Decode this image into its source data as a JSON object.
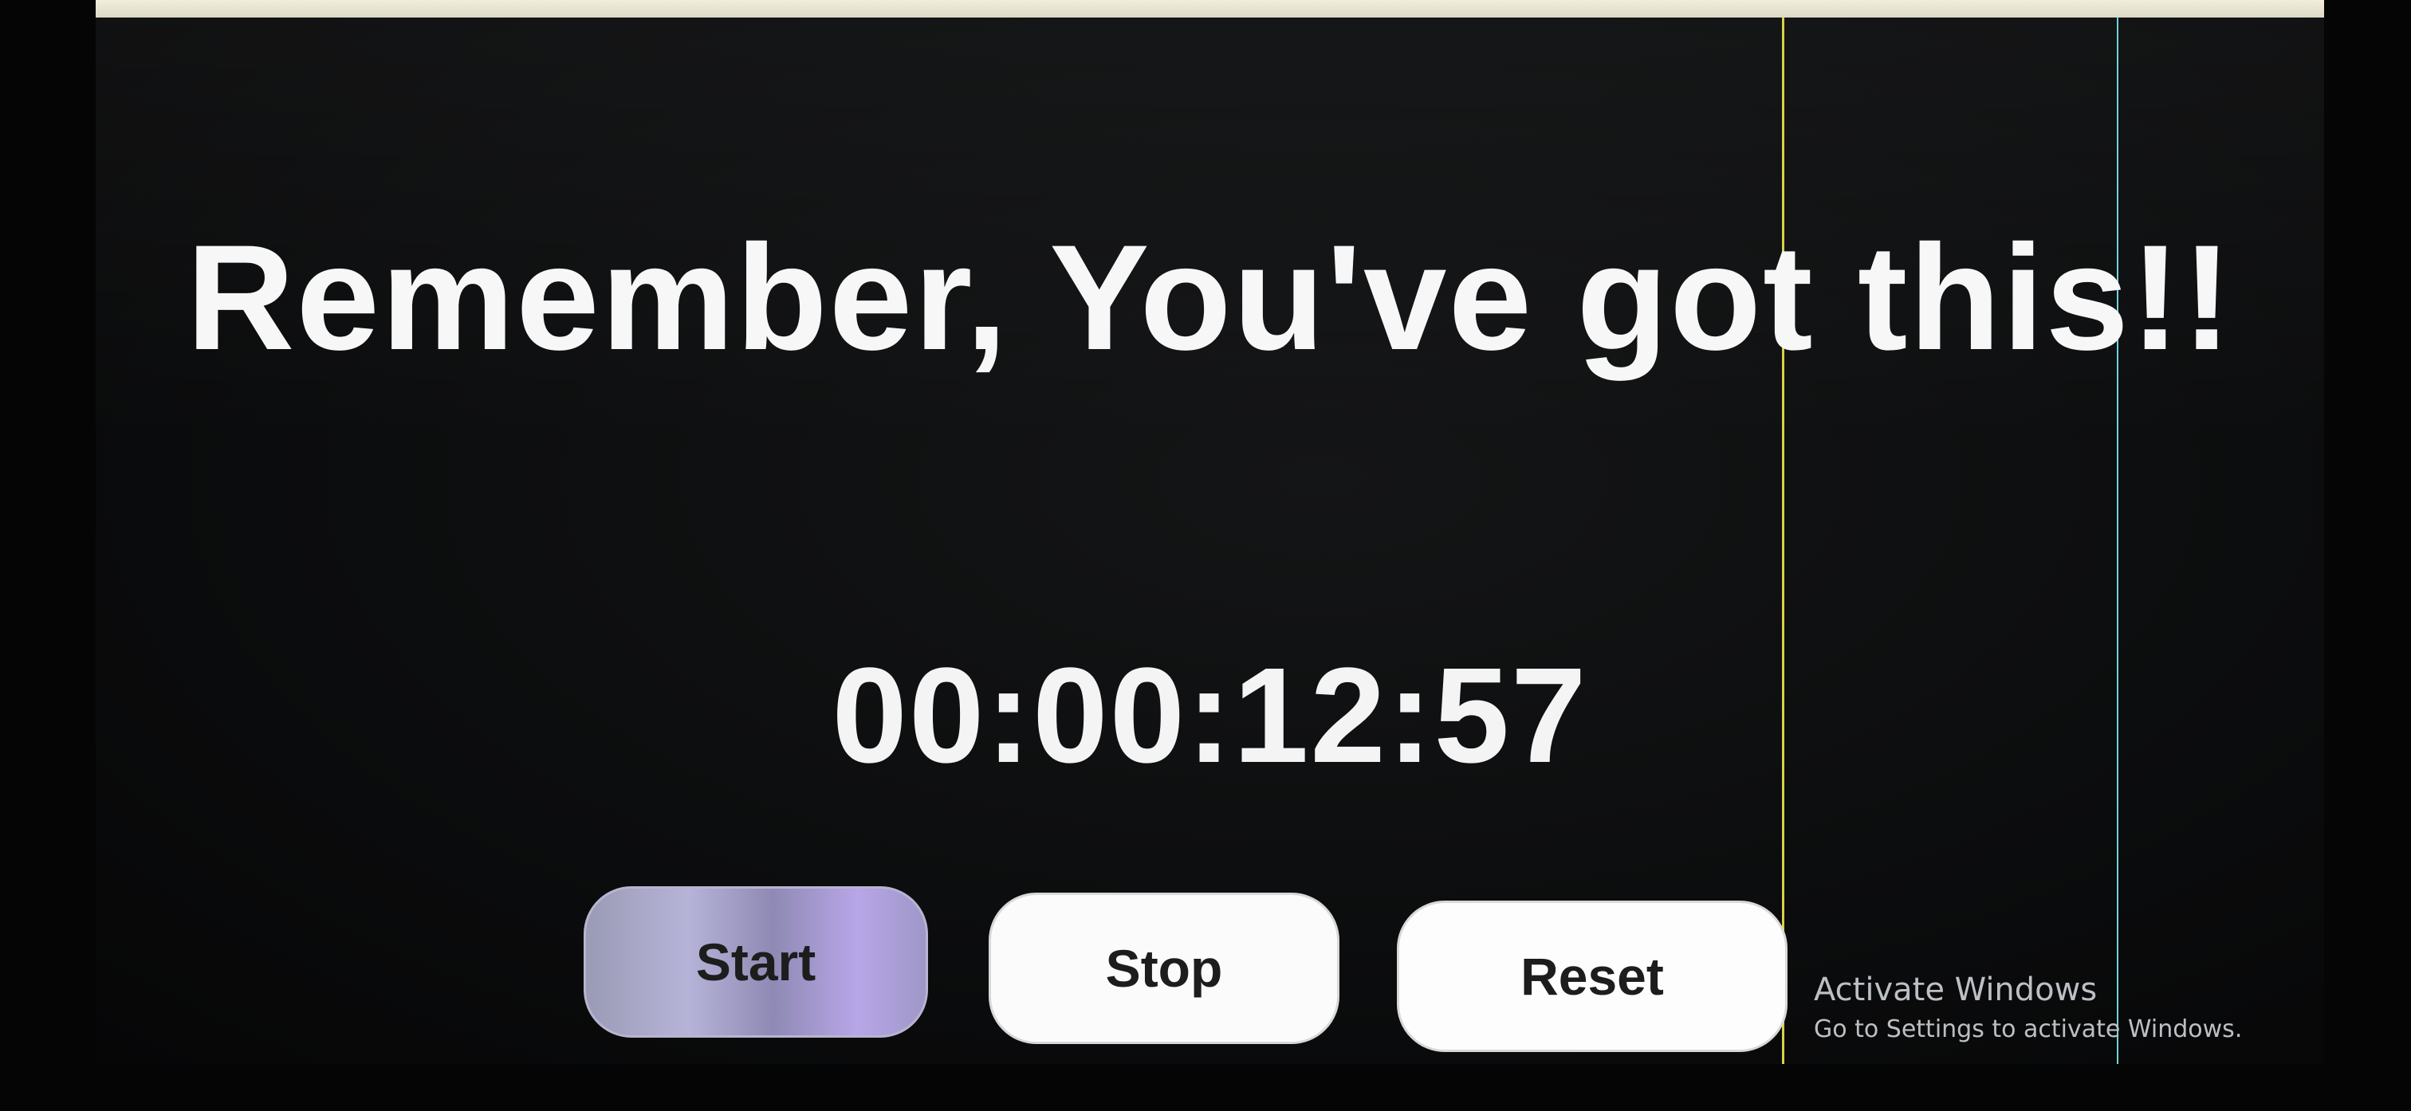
{
  "app": {
    "headline": "Remember, You've got this!!",
    "timer": "00:00:12:57"
  },
  "controls": {
    "start_label": "Start",
    "stop_label": "Stop",
    "reset_label": "Reset"
  },
  "system_watermark": {
    "title": "Activate Windows",
    "subtitle": "Go to Settings to activate Windows."
  },
  "icons": {
    "cursor": "mouse-pointer-icon"
  },
  "colors": {
    "background": "#0c0d0e",
    "text": "#f7f7f7",
    "button_bg": "#fbfbfb",
    "start_button_bg": "#b6b3d8"
  }
}
